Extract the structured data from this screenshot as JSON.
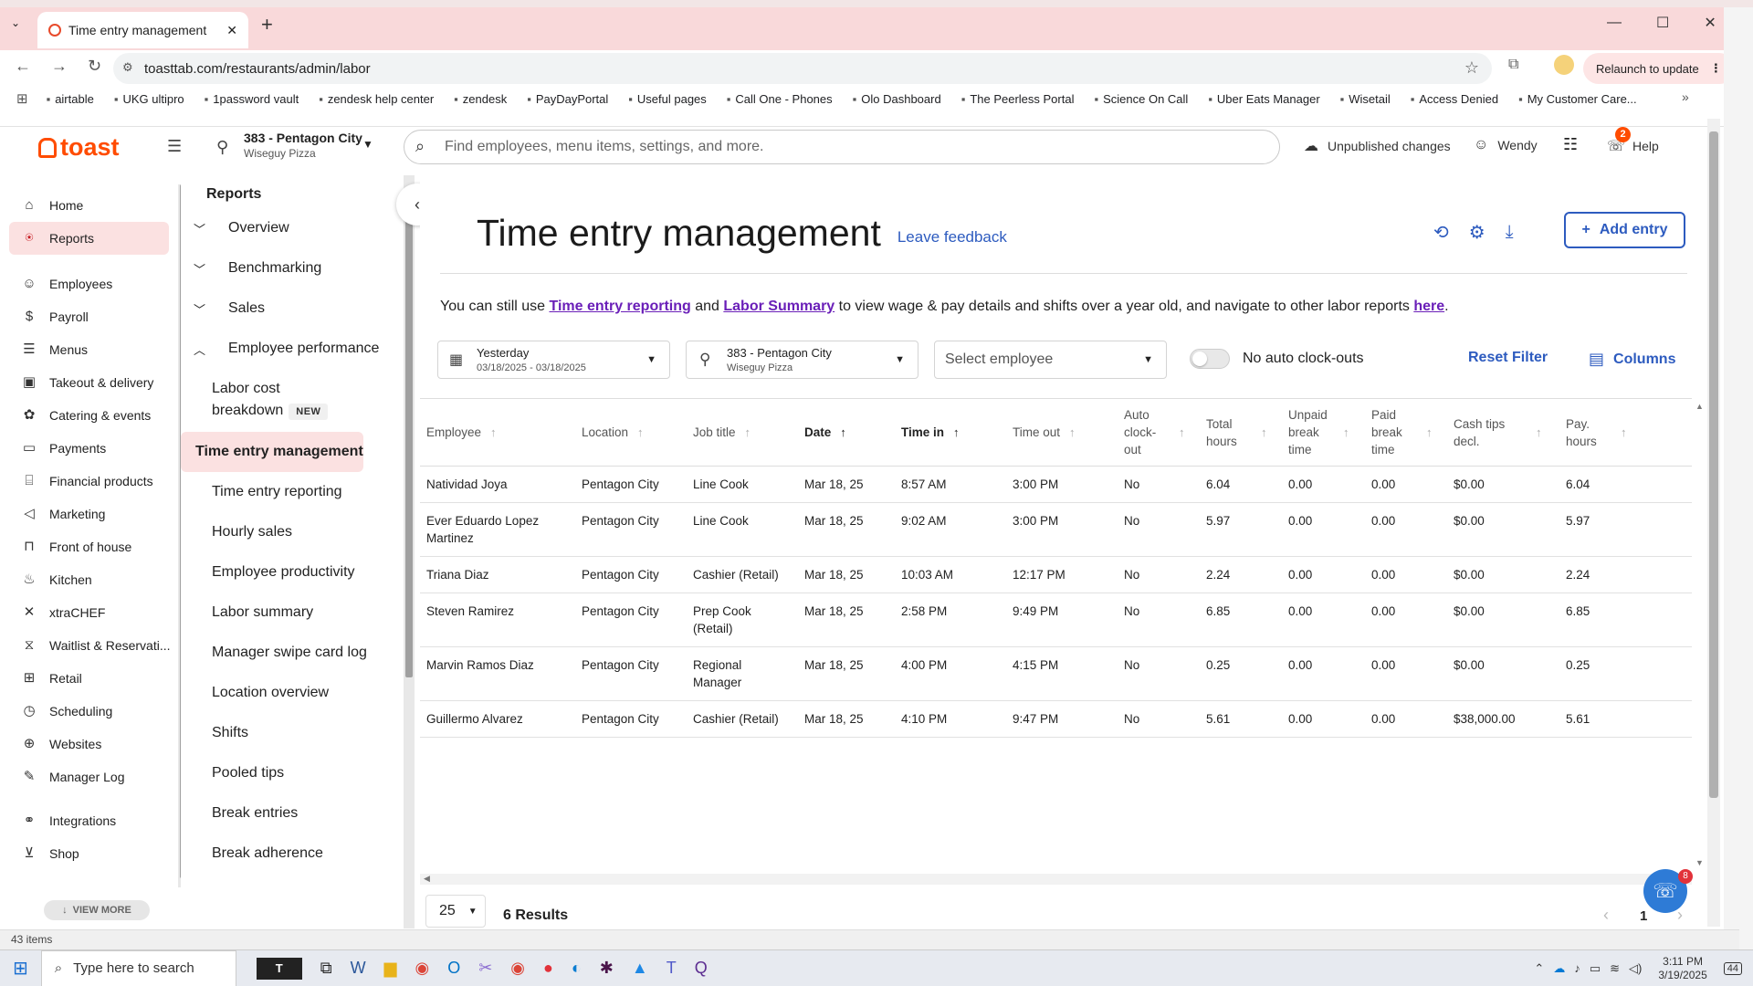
{
  "browser": {
    "tab_title": "Time entry management",
    "url": "toasttab.com/restaurants/admin/labor",
    "relaunch_label": "Relaunch to update",
    "bookmarks": [
      "airtable",
      "UKG ultipro",
      "1password vault",
      "zendesk help center",
      "zendesk",
      "PayDayPortal",
      "Useful pages",
      "Call One - Phones",
      "Olo Dashboard",
      "The Peerless Portal",
      "Science On Call",
      "Uber Eats Manager",
      "Wisetail",
      "Access Denied",
      "My Customer Care..."
    ]
  },
  "header": {
    "logo": "toast",
    "location_name": "383 - Pentagon City",
    "location_sub": "Wiseguy Pizza",
    "search_placeholder": "Find employees, menu items, settings, and more.",
    "unpublished": "Unpublished changes",
    "user": "Wendy",
    "help": "Help",
    "help_badge": "2"
  },
  "sidebar": {
    "items": [
      {
        "label": "Home",
        "icon": "⌂"
      },
      {
        "label": "Reports",
        "icon": "⍟"
      },
      {
        "label": "Employees",
        "icon": "☺"
      },
      {
        "label": "Payroll",
        "icon": "$"
      },
      {
        "label": "Menus",
        "icon": "☰"
      },
      {
        "label": "Takeout & delivery",
        "icon": "▣"
      },
      {
        "label": "Catering & events",
        "icon": "✿"
      },
      {
        "label": "Payments",
        "icon": "▭"
      },
      {
        "label": "Financial products",
        "icon": "⌸"
      },
      {
        "label": "Marketing",
        "icon": "◁"
      },
      {
        "label": "Front of house",
        "icon": "⊓"
      },
      {
        "label": "Kitchen",
        "icon": "♨"
      },
      {
        "label": "xtraCHEF",
        "icon": "✕"
      },
      {
        "label": "Waitlist & Reservati...",
        "icon": "⧖"
      },
      {
        "label": "Retail",
        "icon": "⊞"
      },
      {
        "label": "Scheduling",
        "icon": "◷"
      },
      {
        "label": "Websites",
        "icon": "⊕"
      },
      {
        "label": "Manager Log",
        "icon": "✎"
      }
    ],
    "integrations": "Integrations",
    "shop": "Shop",
    "view_more": "VIEW MORE"
  },
  "reports_nav": {
    "title": "Reports",
    "sections": [
      "Overview",
      "Benchmarking",
      "Sales",
      "Employee performance"
    ],
    "items": [
      "Labor cost breakdown",
      "Time entry management",
      "Time entry reporting",
      "Hourly sales",
      "Employee productivity",
      "Labor summary",
      "Manager swipe card log",
      "Location overview",
      "Shifts",
      "Pooled tips",
      "Break entries",
      "Break adherence"
    ],
    "new_badge": "NEW"
  },
  "main": {
    "title": "Time entry management",
    "feedback": "Leave feedback",
    "add_entry": "Add entry",
    "note_prefix": "You can still use ",
    "note_link1": "Time entry reporting",
    "note_mid": " and ",
    "note_link2": "Labor Summary",
    "note_suffix": " to view wage & pay details and shifts over a year old, and navigate to other labor reports ",
    "note_link3": "here",
    "note_end": ".",
    "date_label": "Yesterday",
    "date_range": "03/18/2025 - 03/18/2025",
    "loc_label": "383 - Pentagon City",
    "loc_sub": "Wiseguy Pizza",
    "employee_placeholder": "Select employee",
    "auto_clockout": "No auto clock-outs",
    "reset": "Reset Filter",
    "columns": "Columns",
    "page_size": "25",
    "results": "6 Results",
    "page": "1"
  },
  "table": {
    "headers": [
      "Employee",
      "Location",
      "Job title",
      "Date",
      "Time in",
      "Time out",
      "Auto clock-out",
      "Total hours",
      "Unpaid break time",
      "Paid break time",
      "Cash tips decl.",
      "Pay. hours"
    ],
    "rows": [
      [
        "Natividad Joya",
        "Pentagon City",
        "Line Cook",
        "Mar 18, 25",
        "8:57 AM",
        "3:00 PM",
        "No",
        "6.04",
        "0.00",
        "0.00",
        "$0.00",
        "6.04"
      ],
      [
        "Ever Eduardo Lopez Martinez",
        "Pentagon City",
        "Line Cook",
        "Mar 18, 25",
        "9:02 AM",
        "3:00 PM",
        "No",
        "5.97",
        "0.00",
        "0.00",
        "$0.00",
        "5.97"
      ],
      [
        "Triana Diaz",
        "Pentagon City",
        "Cashier (Retail)",
        "Mar 18, 25",
        "10:03 AM",
        "12:17 PM",
        "No",
        "2.24",
        "0.00",
        "0.00",
        "$0.00",
        "2.24"
      ],
      [
        "Steven Ramirez",
        "Pentagon City",
        "Prep Cook (Retail)",
        "Mar 18, 25",
        "2:58 PM",
        "9:49 PM",
        "No",
        "6.85",
        "0.00",
        "0.00",
        "$0.00",
        "6.85"
      ],
      [
        "Marvin Ramos Diaz",
        "Pentagon City",
        "Regional Manager",
        "Mar 18, 25",
        "4:00 PM",
        "4:15 PM",
        "No",
        "0.25",
        "0.00",
        "0.00",
        "$0.00",
        "0.25"
      ],
      [
        "Guillermo Alvarez",
        "Pentagon City",
        "Cashier (Retail)",
        "Mar 18, 25",
        "4:10 PM",
        "9:47 PM",
        "No",
        "5.61",
        "0.00",
        "0.00",
        "$38,000.00",
        "5.61"
      ]
    ]
  },
  "status": {
    "items_count": "43 items",
    "chat_badge": "8"
  },
  "taskbar": {
    "search": "Type here to search",
    "time": "3:11 PM",
    "date": "3/19/2025",
    "notif": "44"
  },
  "colors": {
    "brand": "#ff4c00",
    "accent": "#2d5bbf",
    "active_bg": "#fbe1e1",
    "tab_bar": "#f9d9da"
  }
}
